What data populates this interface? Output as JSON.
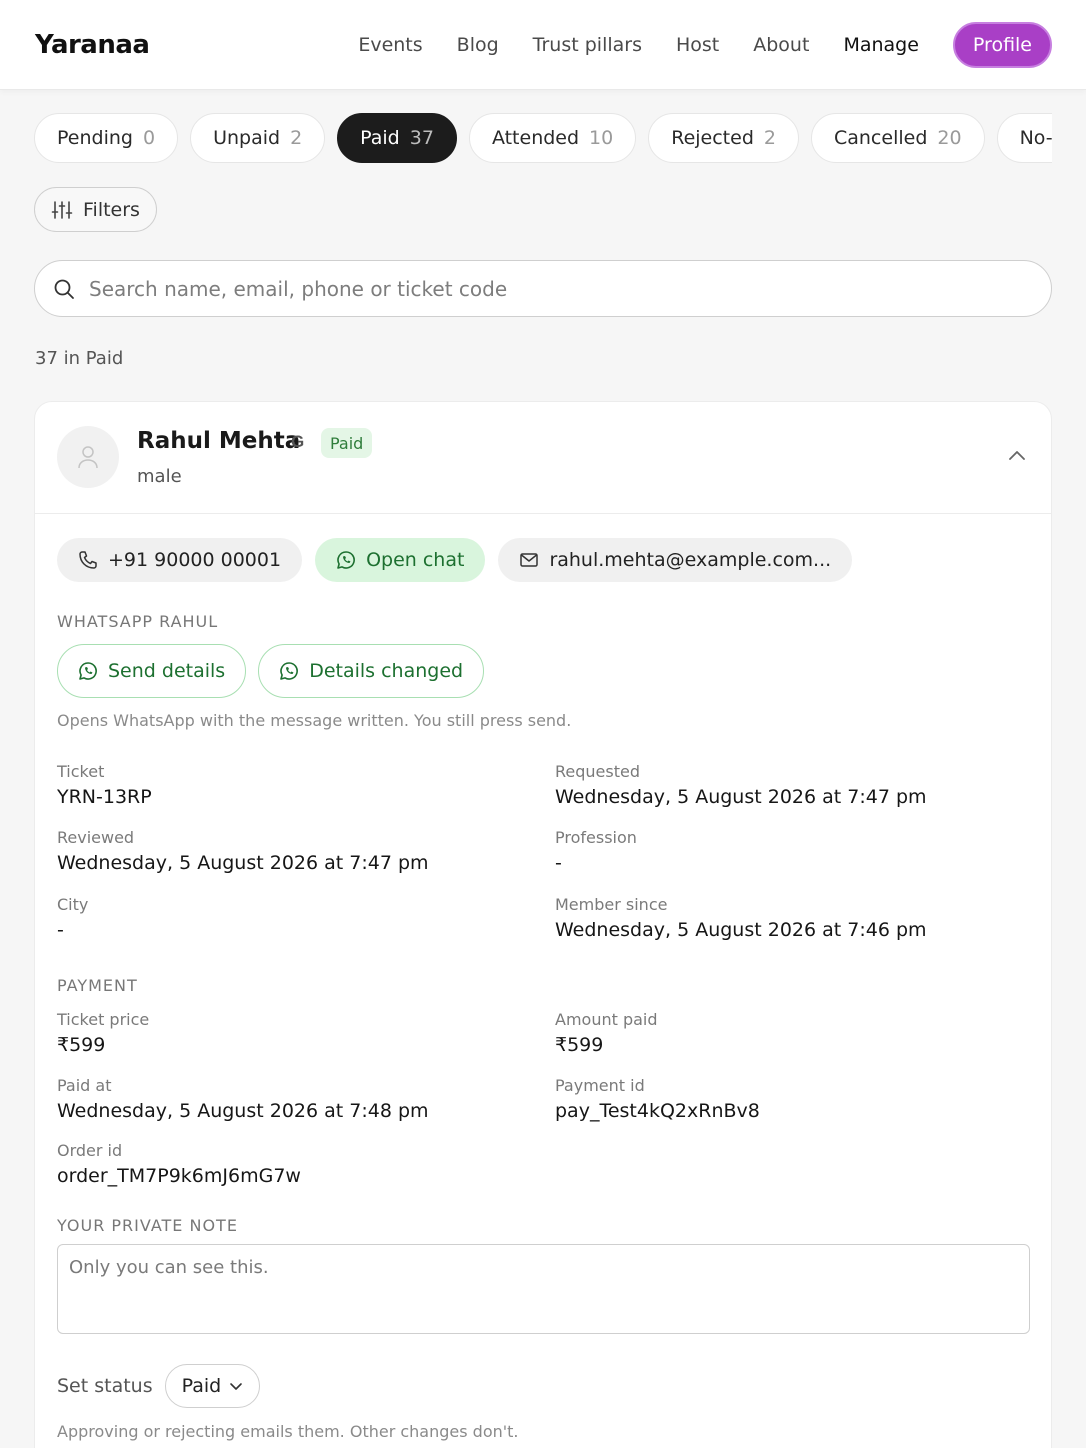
{
  "header": {
    "logo": "Yaranaa",
    "nav": [
      "Events",
      "Blog",
      "Trust pillars",
      "Host",
      "About",
      "Manage"
    ],
    "profile_label": "Profile",
    "accent_color": "#a93fc6"
  },
  "tabs": [
    {
      "label": "Pending",
      "count": "0"
    },
    {
      "label": "Unpaid",
      "count": "2"
    },
    {
      "label": "Paid",
      "count": "37"
    },
    {
      "label": "Attended",
      "count": "10"
    },
    {
      "label": "Rejected",
      "count": "2"
    },
    {
      "label": "Cancelled",
      "count": "20"
    },
    {
      "label": "No-sh",
      "count": ""
    }
  ],
  "filters_label": "Filters",
  "search": {
    "placeholder": "Search name, email, phone or ticket code",
    "value": ""
  },
  "count_line": "37 in Paid",
  "attendee": {
    "name": "Rahul Mehta",
    "google_badge": "G",
    "status_badge": "Paid",
    "gender": "male",
    "phone": "+91 90000 00001",
    "open_chat_label": "Open chat",
    "email": "rahul.mehta@example.com..."
  },
  "whatsapp": {
    "section_label": "WHATSAPP RAHUL",
    "send_details_label": "Send details",
    "details_changed_label": "Details changed",
    "hint": "Opens WhatsApp with the message written. You still press send."
  },
  "details": {
    "ticket_label": "Ticket",
    "ticket": "YRN-13RP",
    "requested_label": "Requested",
    "requested": "Wednesday, 5 August 2026 at 7:47 pm",
    "reviewed_label": "Reviewed",
    "reviewed": "Wednesday, 5 August 2026 at 7:47 pm",
    "profession_label": "Profession",
    "profession": "-",
    "city_label": "City",
    "city": "-",
    "member_since_label": "Member since",
    "member_since": "Wednesday, 5 August 2026 at 7:46 pm"
  },
  "payment": {
    "section_label": "PAYMENT",
    "ticket_price_label": "Ticket price",
    "ticket_price": "₹599",
    "amount_paid_label": "Amount paid",
    "amount_paid": "₹599",
    "paid_at_label": "Paid at",
    "paid_at": "Wednesday, 5 August 2026 at 7:48 pm",
    "payment_id_label": "Payment id",
    "payment_id": "pay_Test4kQ2xRnBv8",
    "order_id_label": "Order id",
    "order_id": "order_TM7P9k6mJ6mG7w"
  },
  "note": {
    "section_label": "YOUR PRIVATE NOTE",
    "placeholder": "Only you can see this.",
    "value": ""
  },
  "status": {
    "label": "Set status",
    "value": "Paid",
    "hint": "Approving or rejecting emails them. Other changes don't."
  }
}
